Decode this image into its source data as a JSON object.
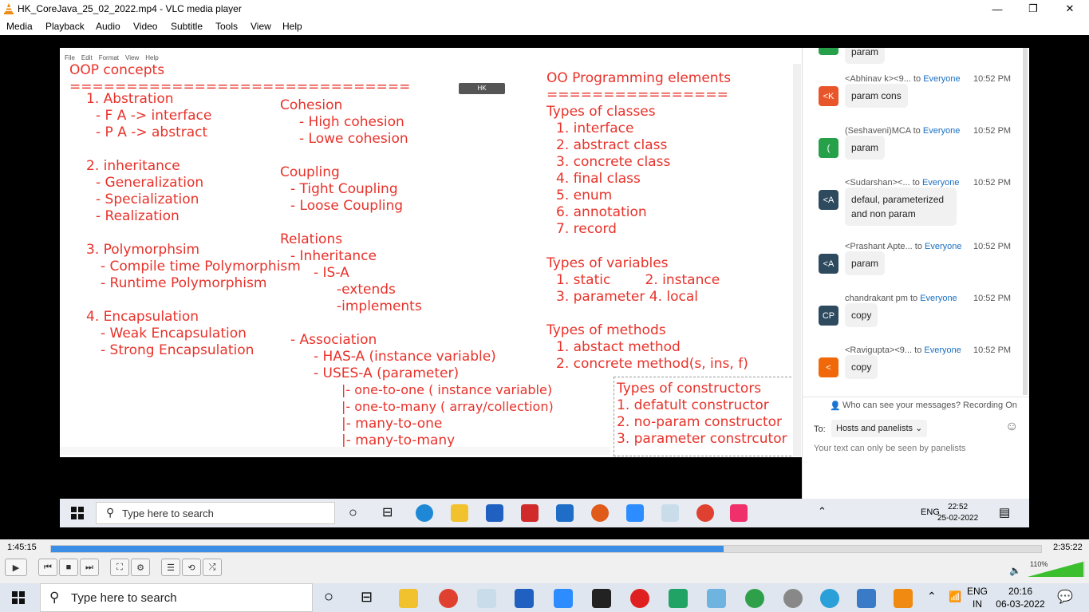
{
  "window": {
    "title": "HK_CoreJava_25_02_2022.mp4 - VLC media player",
    "minimize": "—",
    "maximize": "❐",
    "close": "✕"
  },
  "menu": [
    "Media",
    "Playback",
    "Audio",
    "Video",
    "Subtitle",
    "Tools",
    "View",
    "Help"
  ],
  "notepad": {
    "menu": [
      "File",
      "Edit",
      "Format",
      "View",
      "Help"
    ],
    "hk_badge": "HK",
    "lines": [
      "OOP concepts",
      "==============================",
      "1. Abstration",
      "- F A  -> interface",
      "- P A  -> abstract",
      "2. inheritance",
      "- Generalization",
      "- Specialization",
      "- Realization",
      "3. Polymorphsim",
      "- Compile time Polymorphism",
      "- Runtime Polymorphism",
      "4. Encapsulation",
      "- Weak Encapsulation",
      "- Strong Encapsulation",
      "Cohesion",
      "- High cohesion",
      "- Lowe cohesion",
      "Coupling",
      "- Tight Coupling",
      "- Loose Coupling",
      "Relations",
      "- Inheritance",
      "- IS-A",
      "-extends",
      "-implements",
      "- Association",
      "- HAS-A (instance variable)",
      "- USES-A (parameter)",
      "|- one-to-one    ( instance variable)",
      "|- one-to-many  ( array/collection)",
      "|- many-to-one",
      "|- many-to-many",
      "OO Programming elements",
      "================",
      "Types of classes",
      "1. interface",
      "2. abstract class",
      "3. concrete class",
      "4. final class",
      "5. enum",
      "6. annotation",
      "7. record",
      "Types of variables",
      "1. static        2. instance",
      "3. parameter 4. local",
      "Types of methods",
      "1. abstact method",
      "2. concrete method(s, ins, f)",
      "Types of constructors",
      "1. defatult constructor",
      "2. no-param constructor",
      "3. parameter constrcutor"
    ]
  },
  "chat": {
    "top_partial": "param",
    "messages": [
      {
        "sender": "<Abhinav k><9...",
        "to": "Everyone",
        "time": "10:52 PM",
        "avatar": "<K",
        "text": "param cons",
        "color": "#e8552a"
      },
      {
        "sender": "(Seshaveni)MCA",
        "to": "Everyone",
        "time": "10:52 PM",
        "avatar": "(",
        "text": "param",
        "color": "#27a04a"
      },
      {
        "sender": "<Sudarshan><...",
        "to": "Everyone",
        "time": "10:52 PM",
        "avatar": "<A",
        "text": "defaul, parameterized and non param",
        "color": "#2e4a5e"
      },
      {
        "sender": "<Prashant Apte...",
        "to": "Everyone",
        "time": "10:52 PM",
        "avatar": "<A",
        "text": "param",
        "color": "#2e4a5e"
      },
      {
        "sender": "chandrakant pm",
        "to": "Everyone",
        "time": "10:52 PM",
        "avatar": "CP",
        "text": "copy",
        "color": "#2e4a5e"
      },
      {
        "sender": "<Ravigupta><9...",
        "to": "Everyone",
        "time": "10:52 PM",
        "avatar": "<",
        "text": "copy",
        "color": "#f0680a"
      }
    ],
    "to_word": "to",
    "notice": "Who can see your messages? Recording On",
    "to_label": "To:",
    "recipient": "Hosts and panelists",
    "hint": "Your text can only be seen by panelists"
  },
  "inner_taskbar": {
    "search": "Type here to search",
    "lang": "ENG",
    "time": "22:52",
    "date": "25-02-2022"
  },
  "player": {
    "elapsed": "1:45:15",
    "total": "2:35:22",
    "progress": 0.679,
    "volume": "110%"
  },
  "taskbar": {
    "search": "Type here to search",
    "lang1": "ENG",
    "lang2": "IN",
    "time": "20:16",
    "date": "06-03-2022"
  }
}
